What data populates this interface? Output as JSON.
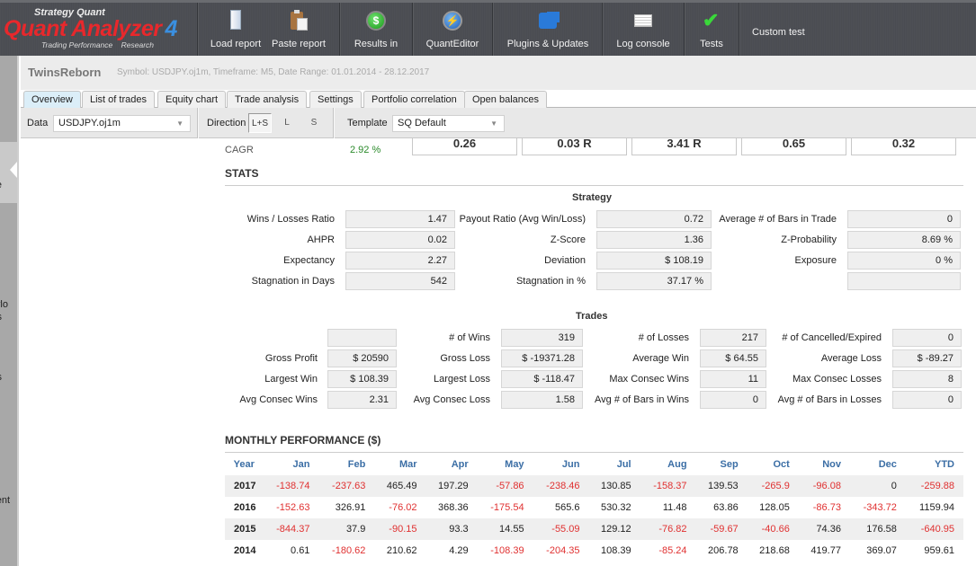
{
  "app": {
    "logo": {
      "brand": "Strategy Quant",
      "name": "Quant Analyzer",
      "version": "4",
      "tagline": "Trading Performance    Research"
    }
  },
  "toolbar": {
    "buttons": [
      {
        "label": "Load report",
        "icon": "folder-icon"
      },
      {
        "label": "Paste report",
        "icon": "clipboard-icon"
      },
      {
        "label": "Results in",
        "icon": "dollar-icon"
      },
      {
        "label": "QuantEditor",
        "icon": "globe-icon"
      },
      {
        "label": "Plugins & Updates",
        "icon": "puzzle-icon"
      },
      {
        "label": "Log console",
        "icon": "book-icon"
      },
      {
        "label": "Tests",
        "icon": "checkmark-icon"
      }
    ],
    "custom_test": "Custom test"
  },
  "sidebar": {
    "fragments": [
      "e",
      "rlo",
      "s",
      "s",
      "ent",
      "."
    ]
  },
  "header": {
    "strategy_name": "TwinsReborn",
    "subtitle": "Symbol: USDJPY.oj1m, Timeframe: M5, Date Range: 01.01.2014 - 28.12.2017"
  },
  "tabs": [
    {
      "label": "Overview",
      "active": true
    },
    {
      "label": "List of trades"
    },
    {
      "label": "Equity chart"
    },
    {
      "label": "Trade analysis"
    },
    {
      "label": "Settings"
    },
    {
      "label": "Portfolio correlation"
    },
    {
      "label": "Open balances"
    }
  ],
  "filters": {
    "data_label": "Data",
    "data_value": "USDJPY.oj1m",
    "direction_label": "Direction",
    "directions": [
      "L+S",
      "L",
      "S"
    ],
    "direction_selected": "L+S",
    "template_label": "Template",
    "template_value": "SQ Default"
  },
  "overview": {
    "cagr_label": "CAGR",
    "cagr_value": "2.92 %",
    "kpis": [
      "0.26",
      "0.03 R",
      "3.41 R",
      "0.65",
      "0.32"
    ]
  },
  "stats": {
    "title": "STATS",
    "strategy": {
      "title": "Strategy",
      "rows": [
        [
          {
            "label": "Wins / Losses Ratio",
            "value": "1.47"
          },
          {
            "label": "Payout Ratio (Avg Win/Loss)",
            "value": "0.72"
          },
          {
            "label": "Average # of Bars in Trade",
            "value": "0"
          }
        ],
        [
          {
            "label": "AHPR",
            "value": "0.02"
          },
          {
            "label": "Z-Score",
            "value": "1.36"
          },
          {
            "label": "Z-Probability",
            "value": "8.69 %"
          }
        ],
        [
          {
            "label": "Expectancy",
            "value": "2.27"
          },
          {
            "label": "Deviation",
            "value": "$ 108.19"
          },
          {
            "label": "Exposure",
            "value": "0 %"
          }
        ],
        [
          {
            "label": "Stagnation in Days",
            "value": "542"
          },
          {
            "label": "Stagnation in %",
            "value": "37.17 %"
          },
          {
            "label": "",
            "value": ""
          }
        ]
      ]
    },
    "trades": {
      "title": "Trades",
      "rows": [
        [
          {
            "label": "",
            "value": ""
          },
          {
            "label": "# of Wins",
            "value": "319"
          },
          {
            "label": "# of Losses",
            "value": "217"
          },
          {
            "label": "# of Cancelled/Expired",
            "value": "0"
          }
        ],
        [
          {
            "label": "Gross Profit",
            "value": "$ 20590"
          },
          {
            "label": "Gross Loss",
            "value": "$ -19371.28"
          },
          {
            "label": "Average Win",
            "value": "$ 64.55"
          },
          {
            "label": "Average Loss",
            "value": "$ -89.27"
          }
        ],
        [
          {
            "label": "Largest Win",
            "value": "$ 108.39"
          },
          {
            "label": "Largest Loss",
            "value": "$ -118.47"
          },
          {
            "label": "Max Consec Wins",
            "value": "11"
          },
          {
            "label": "Max Consec Losses",
            "value": "8"
          }
        ],
        [
          {
            "label": "Avg Consec Wins",
            "value": "2.31"
          },
          {
            "label": "Avg Consec Loss",
            "value": "1.58"
          },
          {
            "label": "Avg # of Bars in Wins",
            "value": "0"
          },
          {
            "label": "Avg # of Bars in Losses",
            "value": "0"
          }
        ]
      ]
    }
  },
  "monthly": {
    "title": "MONTHLY PERFORMANCE ($)",
    "headers": [
      "Year",
      "Jan",
      "Feb",
      "Mar",
      "Apr",
      "May",
      "Jun",
      "Jul",
      "Aug",
      "Sep",
      "Oct",
      "Nov",
      "Dec",
      "YTD"
    ],
    "rows": [
      [
        "2017",
        "-138.74",
        "-237.63",
        "465.49",
        "197.29",
        "-57.86",
        "-238.46",
        "130.85",
        "-158.37",
        "139.53",
        "-265.9",
        "-96.08",
        "0",
        "-259.88"
      ],
      [
        "2016",
        "-152.63",
        "326.91",
        "-76.02",
        "368.36",
        "-175.54",
        "565.6",
        "530.32",
        "11.48",
        "63.86",
        "128.05",
        "-86.73",
        "-343.72",
        "1159.94"
      ],
      [
        "2015",
        "-844.37",
        "37.9",
        "-90.15",
        "93.3",
        "14.55",
        "-55.09",
        "129.12",
        "-76.82",
        "-59.67",
        "-40.66",
        "74.36",
        "176.58",
        "-640.95"
      ],
      [
        "2014",
        "0.61",
        "-180.62",
        "210.62",
        "4.29",
        "-108.39",
        "-204.35",
        "108.39",
        "-85.24",
        "206.78",
        "218.68",
        "419.77",
        "369.07",
        "959.61"
      ]
    ]
  },
  "colors": {
    "negative": "#e03030",
    "positive_cagr": "#2a8a2a",
    "table_header": "#3b6ea5",
    "logo_red": "#e8282c",
    "logo_blue": "#3a8fe0"
  }
}
